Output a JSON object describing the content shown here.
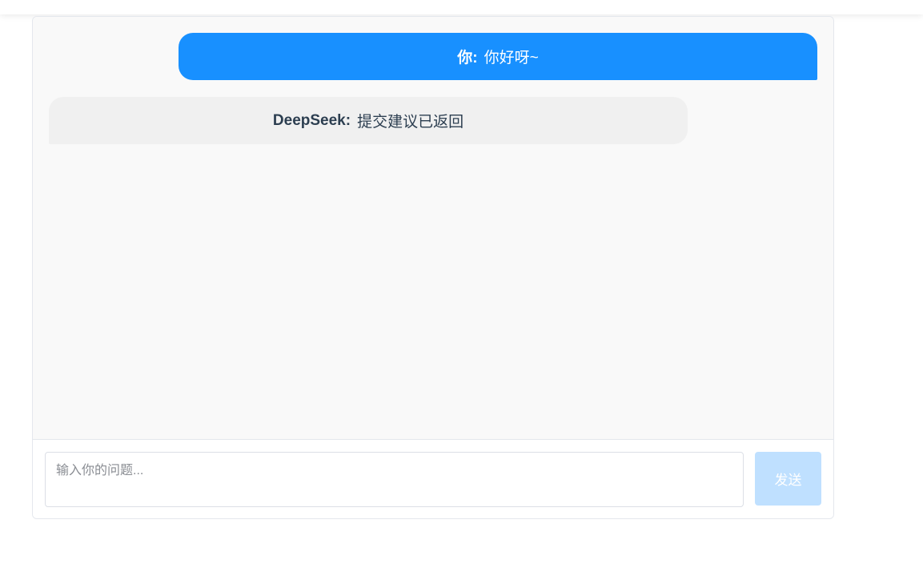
{
  "messages": [
    {
      "role": "user",
      "speaker": "你:",
      "text": "你好呀~"
    },
    {
      "role": "assistant",
      "speaker": "DeepSeek:",
      "text": "提交建议已返回"
    }
  ],
  "input": {
    "placeholder": "输入你的问题...",
    "value": ""
  },
  "send_button": {
    "label": "发送",
    "disabled": true
  },
  "colors": {
    "user_bubble": "#1890ff",
    "assistant_bubble": "#f0f0f0",
    "send_button_disabled": "#bfe0ff"
  }
}
